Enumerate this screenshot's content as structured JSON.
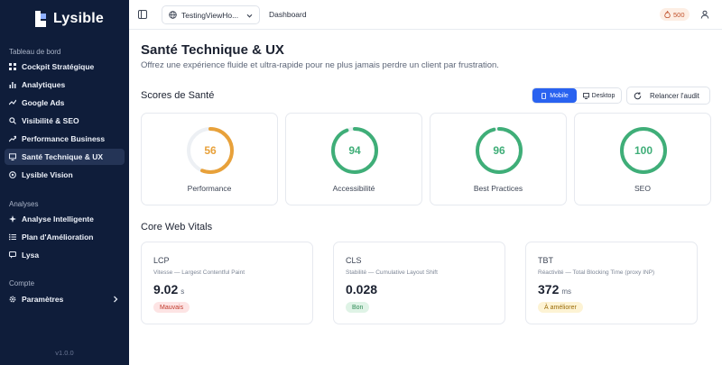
{
  "app": {
    "name": "Lysible",
    "version": "v1.0.0"
  },
  "sidebar": {
    "sections": [
      {
        "label": "Tableau de bord"
      },
      {
        "label": "Analyses"
      },
      {
        "label": "Compte"
      }
    ],
    "items": [
      {
        "label": "Cockpit Stratégique",
        "icon": "grid-icon"
      },
      {
        "label": "Analytiques",
        "icon": "bar-chart-icon"
      },
      {
        "label": "Google Ads",
        "icon": "trend-icon"
      },
      {
        "label": "Visibilité & SEO",
        "icon": "search-icon"
      },
      {
        "label": "Performance Business",
        "icon": "trend-up-icon"
      },
      {
        "label": "Santé Technique & UX",
        "icon": "monitor-icon",
        "active": true
      },
      {
        "label": "Lysible Vision",
        "icon": "eye-icon"
      },
      {
        "label": "Analyse Intelligente",
        "icon": "sparkle-icon"
      },
      {
        "label": "Plan d'Amélioration",
        "icon": "list-icon"
      },
      {
        "label": "Lysa",
        "icon": "chat-icon"
      },
      {
        "label": "Paramètres",
        "icon": "gear-icon"
      }
    ]
  },
  "topbar": {
    "site": "TestingViewHo...",
    "breadcrumb": "Dashboard",
    "credits": "500"
  },
  "page": {
    "title": "Santé Technique & UX",
    "subtitle": "Offrez une expérience fluide et ultra-rapide pour ne plus jamais perdre un client par frustration."
  },
  "scores": {
    "title": "Scores de Santé",
    "device_mobile": "Mobile",
    "device_desktop": "Desktop",
    "rerun": "Relancer l'audit",
    "items": [
      {
        "label": "Performance",
        "value": "56",
        "score": 56,
        "color": "#e8a13a"
      },
      {
        "label": "Accessibilité",
        "value": "94",
        "score": 94,
        "color": "#3fae78"
      },
      {
        "label": "Best Practices",
        "value": "96",
        "score": 96,
        "color": "#3fae78"
      },
      {
        "label": "SEO",
        "value": "100",
        "score": 100,
        "color": "#3fae78"
      }
    ]
  },
  "vitals": {
    "title": "Core Web Vitals",
    "items": [
      {
        "name": "LCP",
        "desc": "Vitesse — Largest Contentful Paint",
        "value": "9.02",
        "unit": "s",
        "badge": "Mauvais",
        "badge_bg": "#fde4e4",
        "badge_fg": "#c0392b"
      },
      {
        "name": "CLS",
        "desc": "Stabilité — Cumulative Layout Shift",
        "value": "0.028",
        "unit": "",
        "badge": "Bon",
        "badge_bg": "#dff3e6",
        "badge_fg": "#2e8a55"
      },
      {
        "name": "TBT",
        "desc": "Réactivité — Total Blocking Time (proxy INP)",
        "value": "372",
        "unit": "ms",
        "badge": "À améliorer",
        "badge_bg": "#fdf3d4",
        "badge_fg": "#9a6b07"
      }
    ]
  }
}
